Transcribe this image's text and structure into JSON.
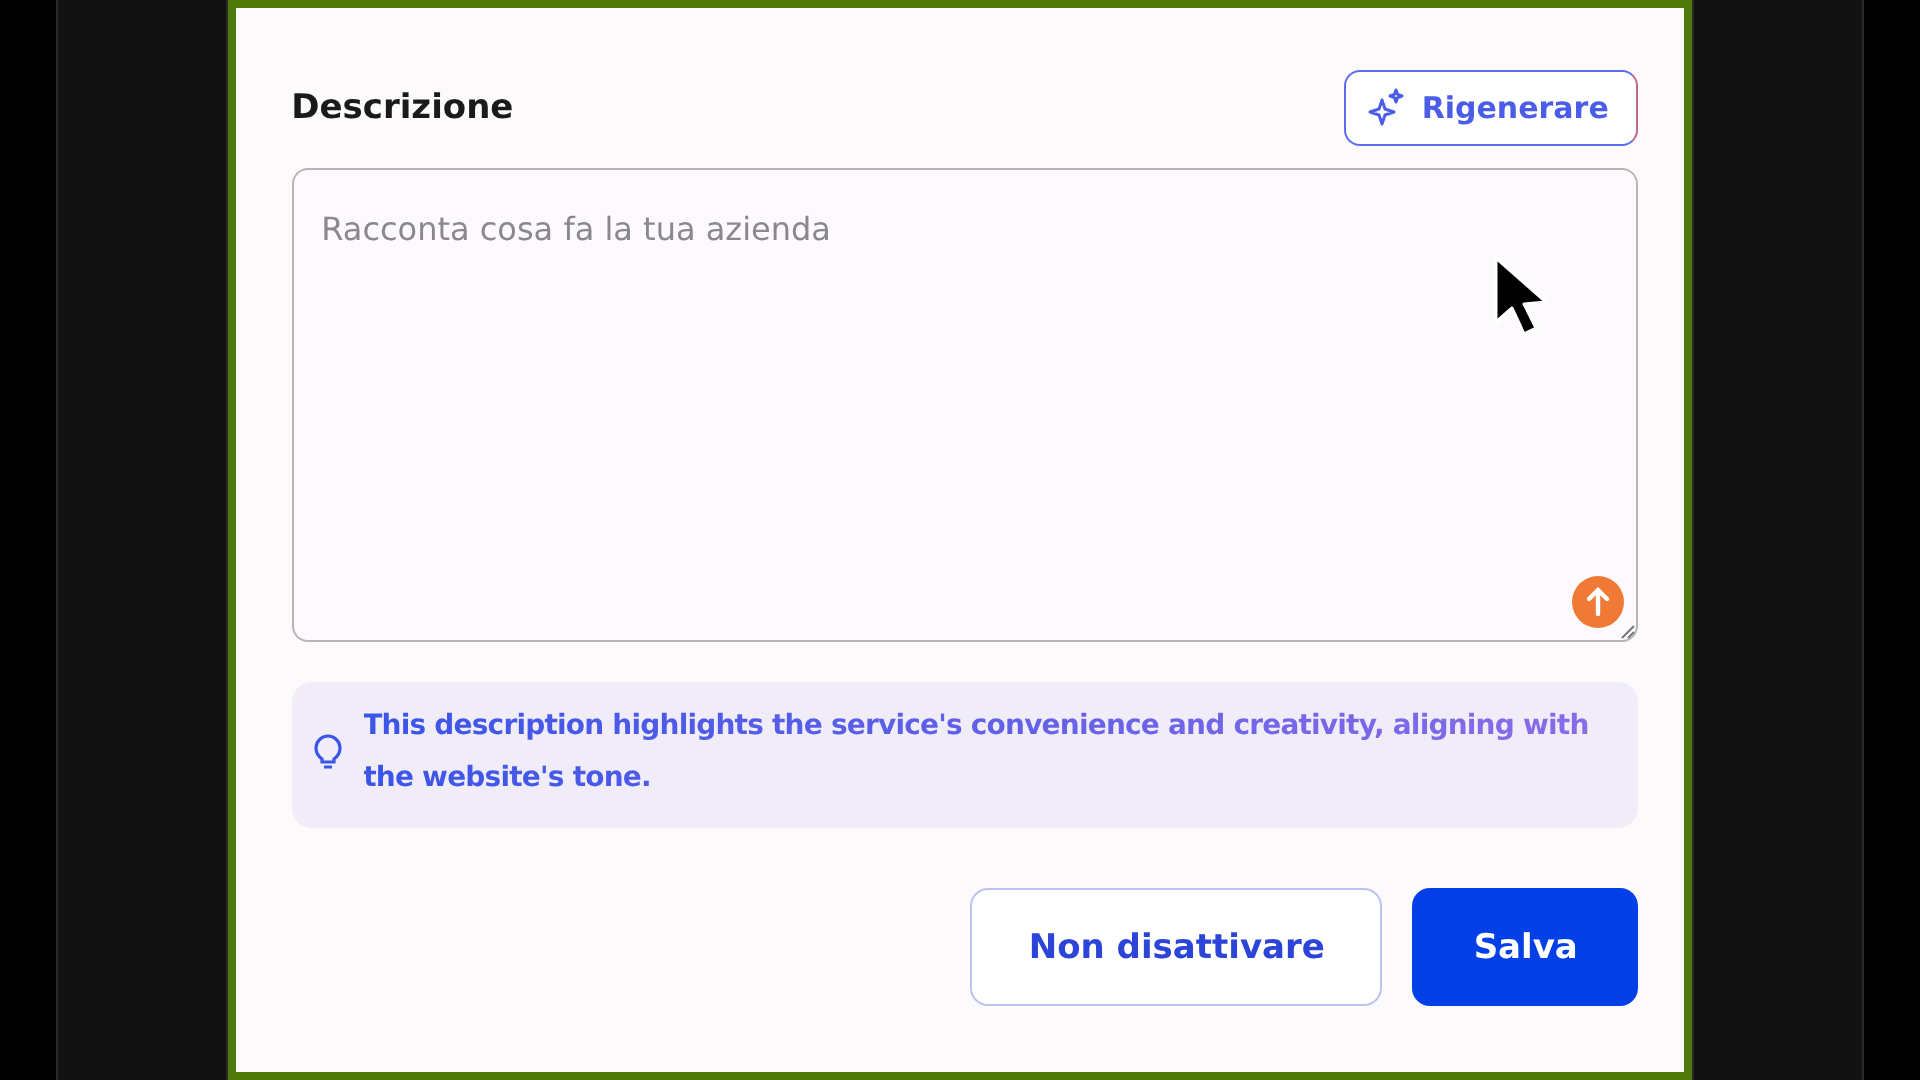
{
  "heading": "Descrizione",
  "regenerate_button": {
    "label": "Rigenerare"
  },
  "description_field": {
    "placeholder": "Racconta cosa fa la tua azienda"
  },
  "hint": {
    "text": "This description highlights the service's convenience and creativity, aligning with the website's tone."
  },
  "buttons": [
    {
      "label": "Non disattivare",
      "kind": "secondary"
    },
    {
      "label": "Salva",
      "kind": "primary"
    }
  ]
}
